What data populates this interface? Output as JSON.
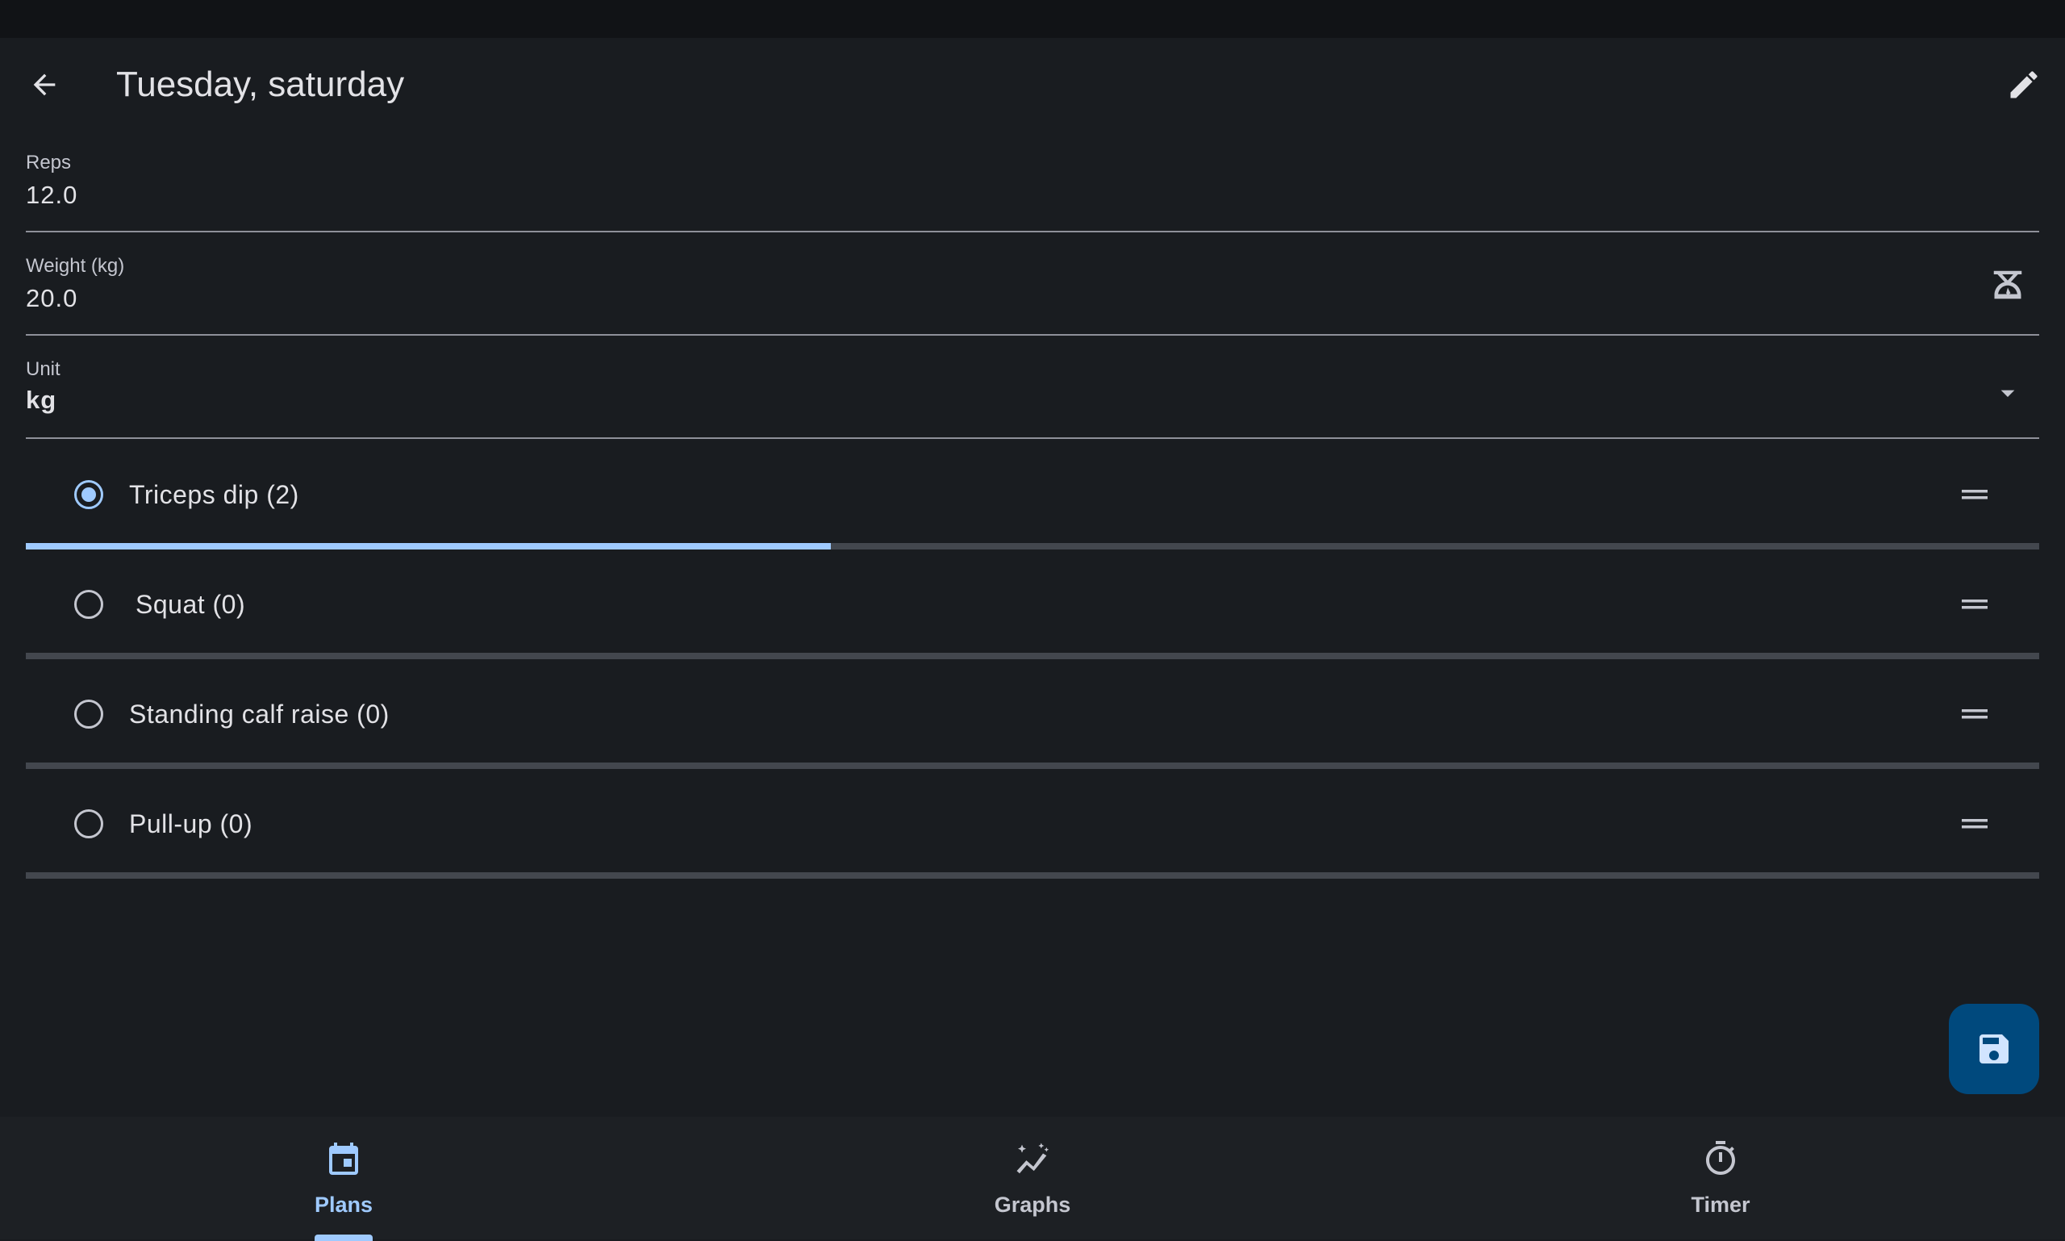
{
  "app_bar": {
    "title": "Tuesday, saturday",
    "back_icon": "arrow-back-icon",
    "edit_icon": "edit-pencil-icon"
  },
  "form": {
    "reps": {
      "label": "Reps",
      "value": "12.0"
    },
    "weight": {
      "label": "Weight (kg)",
      "value": "20.0",
      "icon": "scale-icon"
    },
    "unit": {
      "label": "Unit",
      "value": "kg",
      "icon": "dropdown-arrow-icon"
    }
  },
  "exercises": [
    {
      "label": "Triceps dip (2)",
      "selected": true,
      "progress": 0.4
    },
    {
      "label": "Squat (0)",
      "selected": false,
      "progress": 0
    },
    {
      "label": "Standing calf raise (0)",
      "selected": false,
      "progress": 0
    },
    {
      "label": "Pull-up (0)",
      "selected": false,
      "progress": 0
    }
  ],
  "fab": {
    "icon": "save-icon"
  },
  "bottom_nav": {
    "items": [
      {
        "label": "Plans",
        "icon": "calendar-icon",
        "active": true
      },
      {
        "label": "Graphs",
        "icon": "graph-icon",
        "active": false
      },
      {
        "label": "Timer",
        "icon": "timer-icon",
        "active": false
      }
    ]
  },
  "colors": {
    "background": "#191c20",
    "accent": "#9fcaff",
    "fab": "#00497d",
    "track": "#43474e"
  }
}
